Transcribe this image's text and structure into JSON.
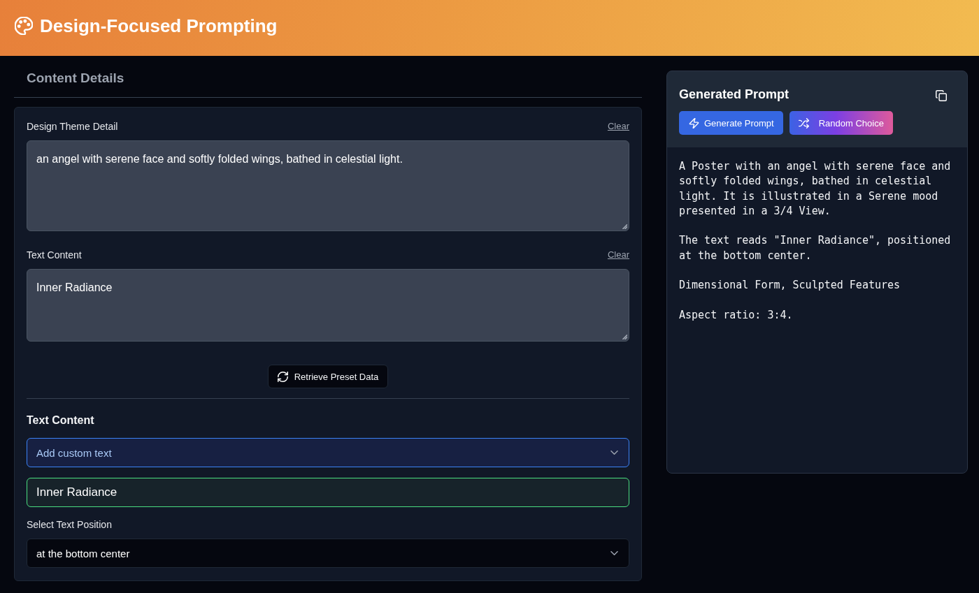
{
  "header": {
    "title": "Design-Focused Prompting"
  },
  "content_details": {
    "heading": "Content Details",
    "fields": [
      {
        "label": "Design Theme Detail",
        "clear": "Clear",
        "value": "an angel with serene face and softly folded wings, bathed in celestial light."
      },
      {
        "label": "Text Content",
        "clear": "Clear",
        "value": "Inner Radiance"
      }
    ],
    "retrieve_button": "Retrieve Preset Data",
    "text_content": {
      "heading": "Text Content",
      "mode_select": {
        "value": "Add custom text",
        "focused": true
      },
      "custom_text": {
        "value": "Inner Radiance",
        "valid": true
      },
      "position_label": "Select Text Position",
      "position_select": {
        "value": "at the bottom center"
      }
    }
  },
  "generated_prompt": {
    "title": "Generated Prompt",
    "buttons": [
      {
        "kind": "generate",
        "label": "Generate Prompt"
      },
      {
        "kind": "random",
        "label": "Random Choice"
      }
    ],
    "paragraphs": [
      "A Poster with an angel with serene face and softly folded wings, bathed in celestial light. It is illustrated in a Serene mood presented in a 3/4 View.",
      "The text reads \"Inner Radiance\", positioned at the bottom center.",
      "Dimensional Form, Sculpted Features",
      "Aspect ratio: 3:4."
    ]
  }
}
